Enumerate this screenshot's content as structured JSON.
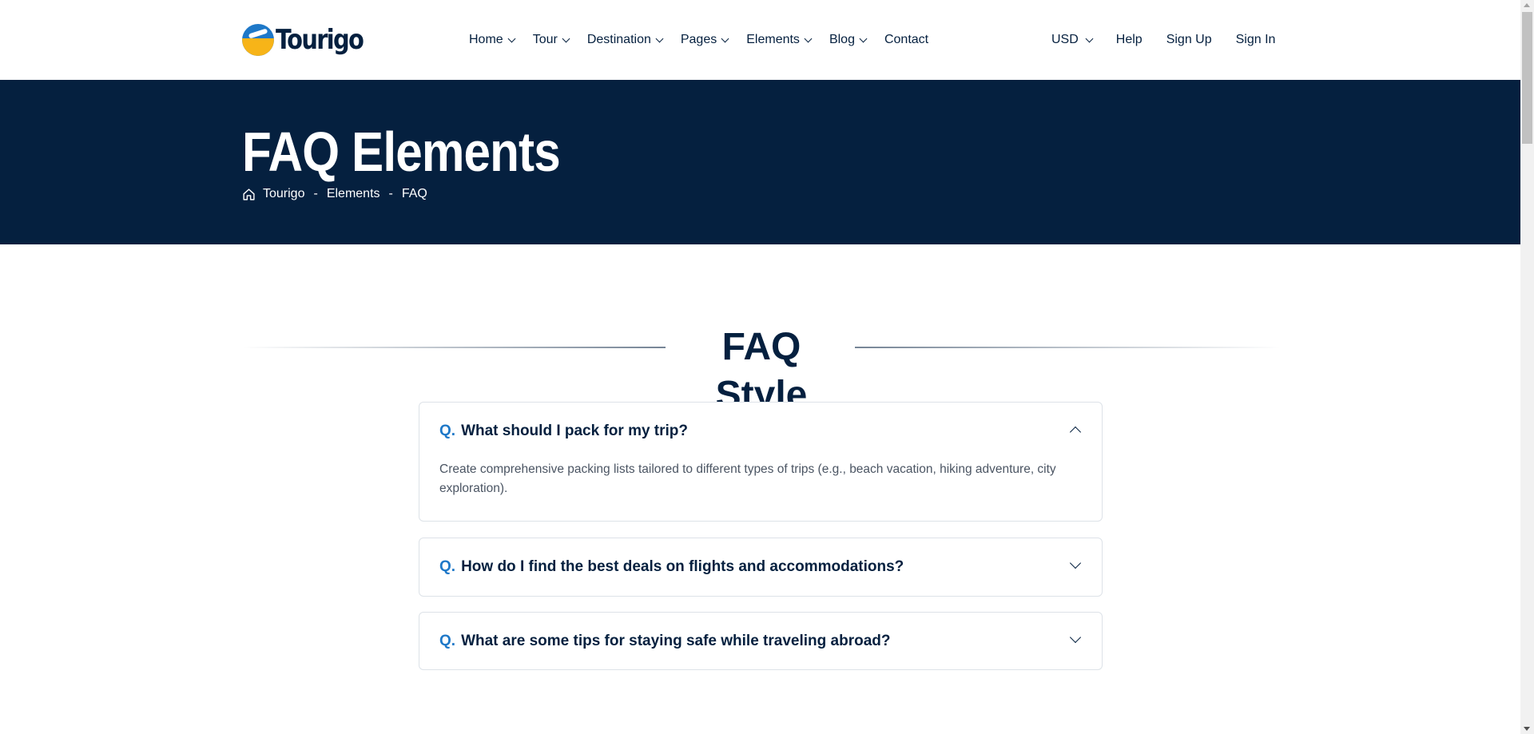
{
  "brand": {
    "name": "Tourigo"
  },
  "nav": {
    "items": [
      {
        "label": "Home",
        "has_dropdown": true
      },
      {
        "label": "Tour",
        "has_dropdown": true
      },
      {
        "label": "Destination",
        "has_dropdown": true
      },
      {
        "label": "Pages",
        "has_dropdown": true
      },
      {
        "label": "Elements",
        "has_dropdown": true
      },
      {
        "label": "Blog",
        "has_dropdown": true
      },
      {
        "label": "Contact",
        "has_dropdown": false
      }
    ]
  },
  "account": {
    "currency": "USD",
    "help": "Help",
    "sign_up": "Sign Up",
    "sign_in": "Sign In"
  },
  "hero": {
    "title": "FAQ Elements",
    "breadcrumb": [
      "Tourigo",
      "Elements",
      "FAQ"
    ],
    "separator": "-"
  },
  "section": {
    "title": "FAQ Style"
  },
  "faq": {
    "prefix": "Q.",
    "items": [
      {
        "question": "What should I pack for my trip?",
        "answer": "Create comprehensive packing lists tailored to different types of trips (e.g., beach vacation, hiking adventure, city exploration).",
        "expanded": true
      },
      {
        "question": "How do I find the best deals on flights and accommodations?",
        "expanded": false
      },
      {
        "question": "What are some tips for staying safe while traveling abroad?",
        "expanded": false
      }
    ]
  },
  "colors": {
    "navy": "#05203f",
    "accent_blue": "#1e78c8",
    "accent_yellow": "#f7b418",
    "border": "#dde2e8"
  },
  "icons": {
    "logo": "globe-plane-icon",
    "breadcrumb_home": "home-icon",
    "dropdown": "chevron-down-icon",
    "faq_open": "chevron-up-icon",
    "faq_closed": "chevron-down-icon"
  }
}
